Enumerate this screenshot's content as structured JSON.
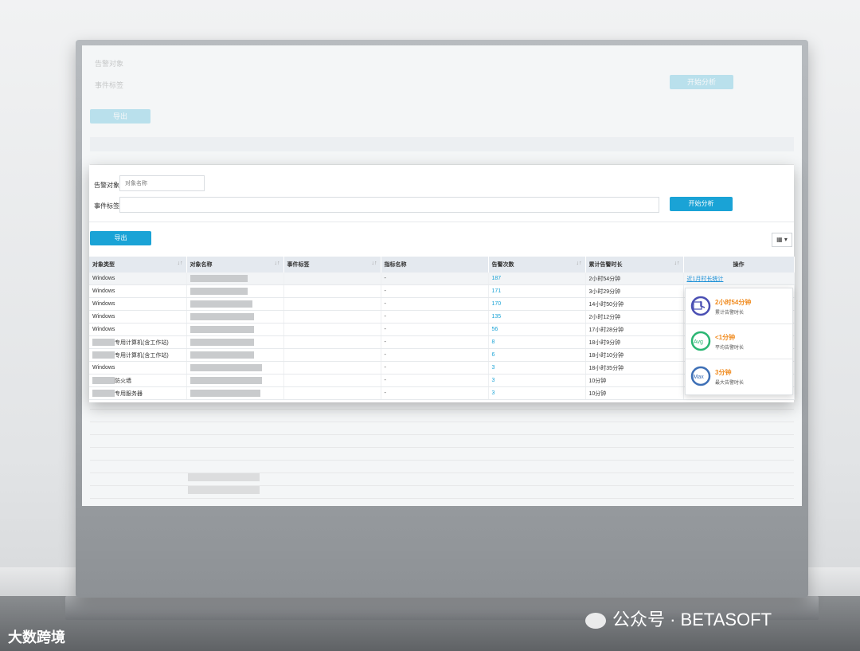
{
  "filters": {
    "alarm_object_label": "告警对象",
    "alarm_object_placeholder": "对象名称",
    "event_tag_label": "事件标签",
    "event_tag_value": "",
    "start_analysis_label": "开始分析"
  },
  "toolbar": {
    "export_label": "导出",
    "columns_icon": "▦ ▾"
  },
  "table": {
    "headers": [
      "对象类型",
      "对象名称",
      "事件标签",
      "指标名称",
      "告警次数",
      "累计告警时长",
      "操作"
    ],
    "rows": [
      {
        "type": "Windows",
        "tag": "",
        "metric": "-",
        "count": "187",
        "duration": "2小时54分钟",
        "action": "近1月时长统计"
      },
      {
        "type": "Windows",
        "tag": "",
        "metric": "-",
        "count": "171",
        "duration": "3小时29分钟",
        "action": ""
      },
      {
        "type": "Windows",
        "tag": "",
        "metric": "-",
        "count": "170",
        "duration": "14小时50分钟",
        "action": ""
      },
      {
        "type": "Windows",
        "tag": "",
        "metric": "-",
        "count": "135",
        "duration": "2小时12分钟",
        "action": ""
      },
      {
        "type": "Windows",
        "tag": "",
        "metric": "-",
        "count": "56",
        "duration": "17小时28分钟",
        "action": ""
      },
      {
        "type": "专用计算机(含工作站)",
        "tag": "",
        "metric": "-",
        "count": "8",
        "duration": "18小时9分钟",
        "action": ""
      },
      {
        "type": "专用计算机(含工作站)",
        "tag": "",
        "metric": "-",
        "count": "6",
        "duration": "18小时10分钟",
        "action": ""
      },
      {
        "type": "Windows",
        "tag": "",
        "metric": "-",
        "count": "3",
        "duration": "18小时35分钟",
        "action": ""
      },
      {
        "type": "防火墙",
        "tag": "",
        "metric": "-",
        "count": "3",
        "duration": "10分钟",
        "action": ""
      },
      {
        "type": "专用服务器",
        "tag": "",
        "metric": "-",
        "count": "3",
        "duration": "10分钟",
        "action": ""
      }
    ]
  },
  "stats_popover": [
    {
      "value": "2小时54分钟",
      "label": "累计告警时长",
      "icon": "calendar-clock-icon"
    },
    {
      "value": "<1分钟",
      "label": "平均告警时长",
      "icon": "average-clock-icon"
    },
    {
      "value": "3分钟",
      "label": "最大告警时长",
      "icon": "max-clock-icon"
    }
  ],
  "watermark": {
    "left": "大数跨境",
    "right": "公众号 · BETASOFT"
  },
  "colors": {
    "accent": "#1aa3d6",
    "warning": "#f08a1d",
    "header_bg": "#e4e9ef"
  }
}
